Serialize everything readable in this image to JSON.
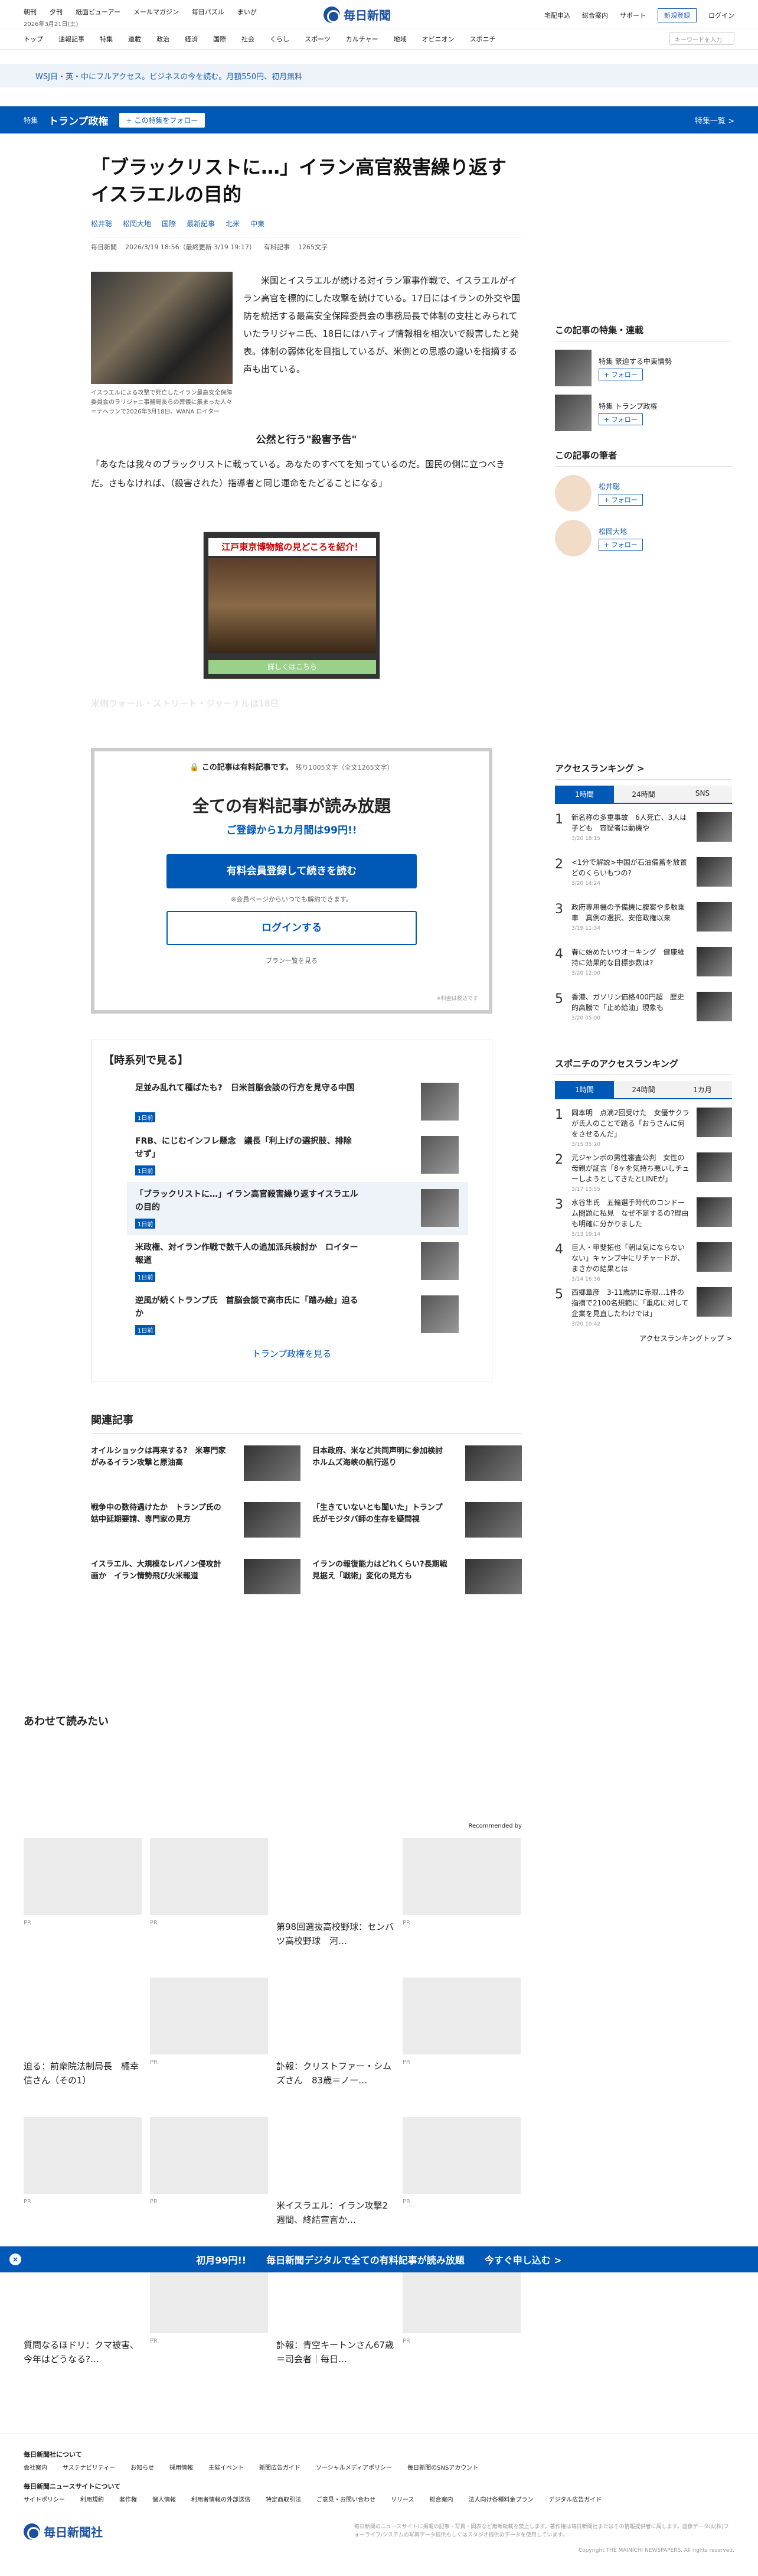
{
  "header": {
    "date": "2026年3月21日(土)",
    "top_links": [
      "朝刊",
      "夕刊",
      "紙面ビューアー",
      "メールマガジン",
      "毎日パズル",
      "まいが"
    ],
    "logo": "毎日新聞",
    "right_links": [
      "宅配申込",
      "総合案内",
      "サポート"
    ],
    "register": "新規登録",
    "login": "ログイン",
    "nav": [
      "トップ",
      "速報記事",
      "特集",
      "連載",
      "政治",
      "経済",
      "国際",
      "社会",
      "くらし",
      "スポーツ",
      "カルチャー",
      "地域",
      "オピニオン",
      "スポニチ"
    ],
    "search_placeholder": "キーワードを入力"
  },
  "promo": "WSJ日・英・中にフルアクセス。ビジネスの今を読む。月額550円、初月無料",
  "feature_bar": {
    "label": "特集",
    "title": "トランプ政権",
    "follow": "+ この特集をフォロー",
    "top": "特集一覧 >"
  },
  "article": {
    "title": "「ブラックリストに…」イラン高官殺害繰り返すイスラエルの目的",
    "authors": [
      "松井聡",
      "松岡大地",
      "国際",
      "最新記事",
      "北米",
      "中東"
    ],
    "meta": [
      "毎日新聞",
      "2026/3/19 18:56（最終更新 3/19 19:17）",
      "有料記事",
      "1265文字"
    ],
    "lead": "米国とイスラエルが続ける対イラン軍事作戦で、イスラエルがイラン高官を標的にした攻撃を続けている。17日にはイランの外交や国防を統括する最高安全保障委員会の事務局長で体制の支柱とみられていたラリジャニ氏、18日にはハティブ情報相を相次いで殺害したと発表。体制の弱体化を目指しているが、米側との思惑の違いを指摘する声も出ている。",
    "caption": "イスラエルによる攻撃で死亡したイラン最高安全保障委員会のラリジャニ事務局長らの葬儀に集まった人々＝テヘランで2026年3月18日、WANA ロイター",
    "subhead": "公然と行う\"殺害予告\"",
    "quote": "「あなたは我々のブラックリストに載っている。あなたのすべてを知っているのだ。国民の側に立つべきだ。さもなければ、（殺害された）指導者と同じ運命をたどることになる」",
    "ad_banner": "江戸東京博物館の見どころを紹介！",
    "ad_foot": "詳しくはこちら",
    "fade_text": "米側ウォール・ストリート・ジャーナルは18日"
  },
  "paywall": {
    "note": "この記事は有料記事です。",
    "remain": "残り1005文字（全文1265文字）",
    "title": "全ての有料記事が読み放題",
    "sub": "ご登録から1カ月間は99円!!",
    "btn1": "有料会員登録して続きを読む",
    "note2": "※会員ページからいつでも解約できます。",
    "btn2": "ログインする",
    "plan": "プラン一覧を見る",
    "tax": "※料金は税込です"
  },
  "timeline": {
    "head": "【時系列で見る】",
    "items": [
      {
        "title": "足並み乱れて種ばたも?　日米首脳会談の行方を見守る中国",
        "date": "1日前"
      },
      {
        "title": "FRB、にじむインフレ懸念　議長「利上げの選択肢、排除せず」",
        "date": "1日前"
      },
      {
        "title": "「ブラックリストに…」イラン高官殺害繰り返すイスラエルの目的",
        "date": "1日前"
      },
      {
        "title": "米政権、対イラン作戦で数千人の追加派兵検討か　ロイター報道",
        "date": "1日前"
      },
      {
        "title": "逆風が続くトランプ氏　首脳会談で高市氏に「踏み絵」迫るか",
        "date": "1日前"
      }
    ],
    "more": "トランプ政権を見る"
  },
  "related": {
    "head": "関連記事",
    "items": [
      "オイルショックは再来する?　米専門家がみるイラン攻撃と原油高",
      "日本政府、米など共同声明に参加検討　ホルムズ海峡の航行巡り",
      "戦争中の数待遇けたか　トランプ氏の姑中延期要請、専門家の見方",
      "「生きていないとも聞いた」トランプ氏がモジタバ師の生存を疑問視",
      "イスラエル、大規模なレバノン侵攻計画か　イラン情勢飛び火米報道",
      "イランの報復能力はどれくらい?長期戦見据え「戦術」変化の見方も"
    ]
  },
  "sidebar": {
    "feature_head": "この記事の特集・連載",
    "features": [
      {
        "label": "特集 緊迫する中東情勢",
        "follow": "+ フォロー"
      },
      {
        "label": "特集 トランプ政権",
        "follow": "+ フォロー"
      }
    ],
    "author_head": "この記事の筆者",
    "authors": [
      {
        "name": "松井聡",
        "follow": "+ フォロー"
      },
      {
        "name": "松岡大地",
        "follow": "+ フォロー"
      }
    ]
  },
  "ranking": {
    "head": "アクセスランキング >",
    "tabs": [
      "1時間",
      "24時間",
      "SNS"
    ],
    "items": [
      {
        "title": "新名称の多重事故　6人死亡、3人は子ども　容疑者は動機や",
        "date": "3/20 18:15"
      },
      {
        "title": "<1分で解説>中国が石油備蓄を放置　どのくらいもつの?",
        "date": "3/20 14:24"
      },
      {
        "title": "政府専用機の予備機に腹案や多数乗車　真例の選択、安倍政権以来",
        "date": "3/19 11:34"
      },
      {
        "title": "春に始めたいウオーキング　健康維持に効果的な目標歩数は?",
        "date": "3/20 12:00"
      },
      {
        "title": "香港、ガソリン価格400円超　歴史的高騰で「止め給油」現象も",
        "date": "3/20 05:00"
      }
    ]
  },
  "ranking2": {
    "head": "スポニチのアクセスランキング",
    "tabs": [
      "1時間",
      "24時間",
      "1カ月"
    ],
    "items": [
      {
        "title": "岡本明　点滴2回受けた　女優サクラが氏人のことで踏る「おうさんに何をさせるんだ」",
        "date": "3/15 05:20"
      },
      {
        "title": "元ジャンボの男性審査公判　女性の母親が証言「8ヶを気持ち悪いしチューしようとしてきたとLINEが」",
        "date": "3/17 13:55"
      },
      {
        "title": "水谷隼氏　五輪選手時代のコンドーム問題に私見　なぜ不足するの?理由も明確に分かりました",
        "date": "3/13 19:14"
      },
      {
        "title": "巨人・甲斐拓也「朝は気にならないない」キャンプ中にリチャードが、まさかの結果とは",
        "date": "3/14 16:36"
      },
      {
        "title": "西郷章彦　3-11歳訪に赤眼…1件の指摘で2100名規範に「重応に対して企業を見直したわけでは」",
        "date": "3/20 10:42"
      }
    ],
    "more": "アクセスランキングトップ >"
  },
  "readtoo": {
    "head": "あわせて読みたい",
    "rec": "Recommended by",
    "cards": [
      {
        "title": "",
        "pr": "PR"
      },
      {
        "title": "",
        "pr": "PR"
      },
      {
        "title": "第98回選抜高校野球：センバツ高校野球　河…",
        "pr": ""
      },
      {
        "title": "",
        "pr": "PR"
      },
      {
        "title": "迫る：前衆院法制局長　橘幸信さん（その1）",
        "pr": ""
      },
      {
        "title": "",
        "pr": "PR"
      },
      {
        "title": "訃報：クリストファー・シムズさん　83歳＝ノー…",
        "pr": ""
      },
      {
        "title": "",
        "pr": "PR"
      },
      {
        "title": "",
        "pr": "PR"
      },
      {
        "title": "",
        "pr": "PR"
      },
      {
        "title": "米イスラエル：イラン攻撃2週間、終結宣言か…",
        "pr": ""
      },
      {
        "title": "",
        "pr": "PR"
      },
      {
        "title": "質問なるほドリ：クマ被害、今年はどうなる?…",
        "pr": ""
      },
      {
        "title": "",
        "pr": "PR"
      },
      {
        "title": "訃報：青空キートンさん67歳＝司会者｜毎日…",
        "pr": ""
      },
      {
        "title": "",
        "pr": "PR"
      }
    ]
  },
  "sticky": {
    "text1": "初月99円!!",
    "text2": "毎日新聞デジタルで全ての有料記事が読み放題",
    "text3": "今すぐ申し込む >"
  },
  "footer": {
    "h1": "毎日新聞社について",
    "links1": [
      "会社案内",
      "サステナビリティー",
      "お知らせ",
      "採用情報",
      "主催イベント",
      "新聞広告ガイド",
      "ソーシャルメディアポリシー",
      "毎日新聞のSNSアカウント"
    ],
    "h2": "毎日新聞ニュースサイトについて",
    "links2": [
      "サイトポリシー",
      "利用規約",
      "著作権",
      "個人情報",
      "利用者情報の外部送信",
      "特定商取引法",
      "ご意見・お問い合わせ",
      "リリース",
      "総合案内",
      "法人向け各種料金プラン",
      "デジタル広告ガイド"
    ],
    "logo": "毎日新聞社",
    "legal": "毎日新聞のニュースサイトに掲載の記事・写真・図表など無断転載を禁止します。著作権は毎日新聞社またはその情報提供者に属します。画像データは(株)フォーライフ/システムの写真データ提供もしくはスタジオ提供のデータを使用しています。",
    "copy": "Copyright THE MAINICHI NEWSPAPERS. All rights reserved."
  }
}
